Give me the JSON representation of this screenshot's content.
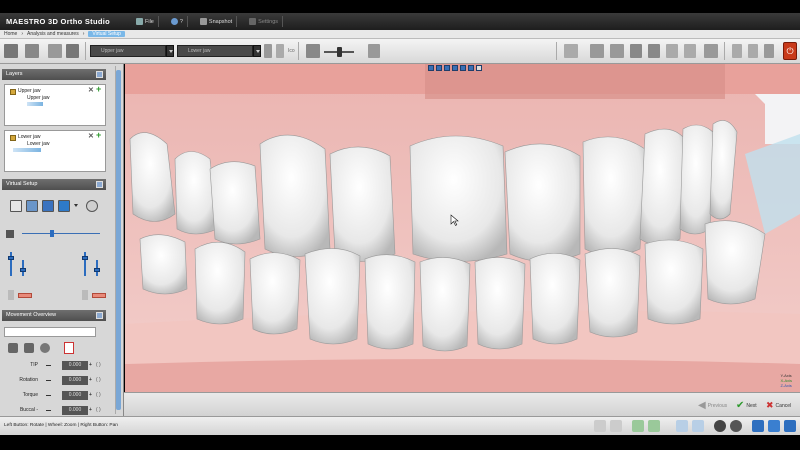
{
  "app": {
    "title": "MAESTRO 3D Ortho Studio"
  },
  "menu": [
    {
      "label": "File",
      "icon": "file-icon"
    },
    {
      "label": "?",
      "icon": "help-icon"
    },
    {
      "label": "Snapshot",
      "icon": "snapshot-icon"
    },
    {
      "label": "Settings",
      "icon": "settings-icon"
    }
  ],
  "breadcrumb": [
    "Home",
    "Analysis and measures",
    "Virtual Setup"
  ],
  "toolbar": {
    "upper_select": "Upper jaw",
    "lower_select": "Lower jaw",
    "ico_label": "Ico"
  },
  "layers_panel": {
    "title": "Layers",
    "groups": [
      {
        "name": "Upper jaw",
        "child": "Upper jaw"
      },
      {
        "name": "Lower jaw",
        "child": "Lower jaw"
      }
    ]
  },
  "virtual_setup": {
    "title": "Virtual Setup"
  },
  "movement_overview": {
    "title": "Movement Overview",
    "rows": [
      {
        "label": "TIP",
        "value": "0.000"
      },
      {
        "label": "Rotation",
        "value": "0.000"
      },
      {
        "label": "Torque",
        "value": "0.000"
      },
      {
        "label": "Buccal - Lingual",
        "value": "0.000"
      }
    ]
  },
  "viewport": {
    "axes": [
      "Y-Axis",
      "X-Axis",
      "Z-Axis"
    ]
  },
  "nav": {
    "previous": "Previous",
    "next": "Next",
    "cancel": "Cancel"
  },
  "status": {
    "hint": "Left Button: Rotate | Wheel: Zoom | Right Button: Pan"
  },
  "colors": {
    "accent": "#7ab8e8",
    "close": "#c83a1a",
    "gum": "#e8a0a0",
    "tooth": "#f4f4f4"
  }
}
